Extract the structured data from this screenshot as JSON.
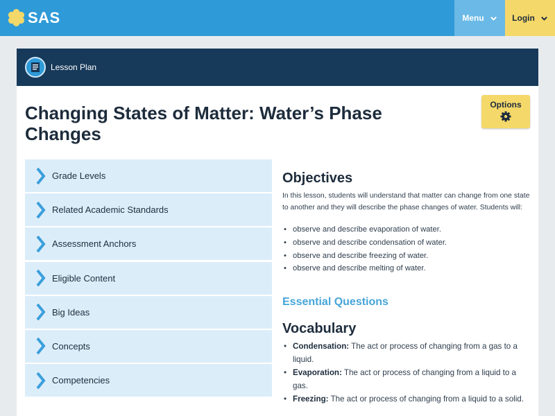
{
  "header": {
    "logo_text": "SAS",
    "menu_label": "Menu",
    "login_label": "Login",
    "colors": {
      "bar": "#2f9ad8",
      "menu": "#6bb9e6",
      "login": "#f5d86a"
    }
  },
  "lesson_bar": {
    "label": "Lesson Plan",
    "icon": "document-icon"
  },
  "page": {
    "title": "Changing States of Matter: Water’s Phase Changes",
    "options_label": "Options",
    "options_icon": "gear-icon"
  },
  "accordion": [
    {
      "label": "Grade Levels"
    },
    {
      "label": "Related Academic Standards"
    },
    {
      "label": "Assessment Anchors"
    },
    {
      "label": "Eligible Content"
    },
    {
      "label": "Big Ideas"
    },
    {
      "label": "Concepts"
    },
    {
      "label": "Competencies"
    }
  ],
  "objectives": {
    "heading": "Objectives",
    "intro": "In this lesson, students will understand that matter can change from one state to another and they will describe the phase changes of water. Students will:",
    "items": [
      "observe and describe evaporation of water.",
      "observe and describe condensation of water.",
      "observe and describe freezing of water.",
      "observe and describe melting of water."
    ]
  },
  "essential_questions": {
    "heading": "Essential Questions"
  },
  "vocabulary": {
    "heading": "Vocabulary",
    "items": [
      {
        "term": "Condensation:",
        "definition": "The act or process of changing from a gas to a liquid."
      },
      {
        "term": "Evaporation:",
        "definition": "The act or process of changing from a liquid to a gas."
      },
      {
        "term": "Freezing:",
        "definition": "The act or process of changing from a liquid to a solid."
      }
    ]
  }
}
